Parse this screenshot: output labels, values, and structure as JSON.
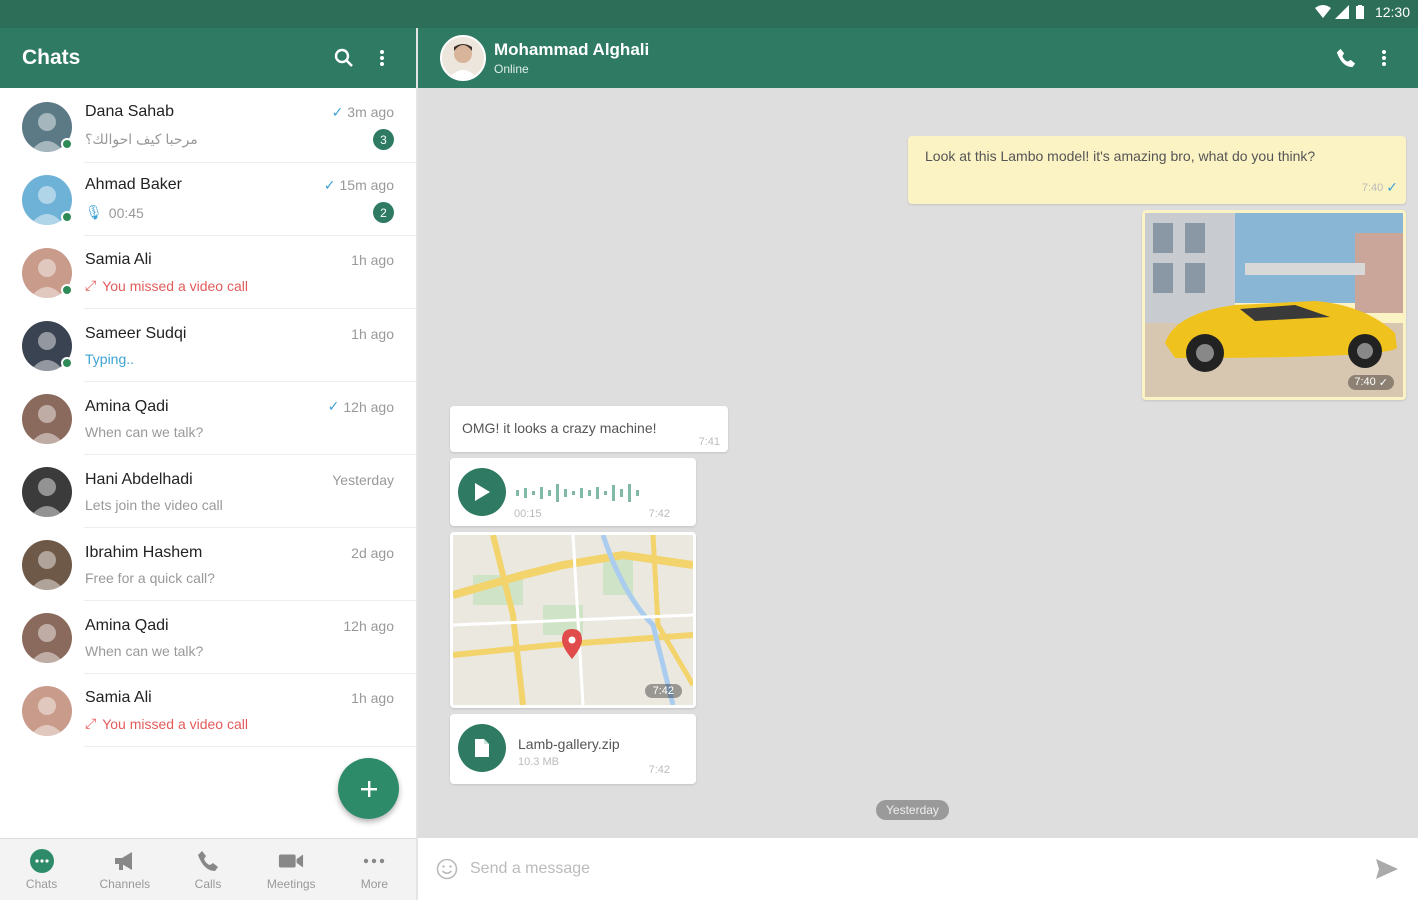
{
  "status": {
    "time": "12:30"
  },
  "sidebar": {
    "title": "Chats",
    "chats": [
      {
        "name": "Dana Sahab",
        "time": "3m ago",
        "message": "مرحبا كيف احوالك؟",
        "read": true,
        "badge": "3",
        "online": true,
        "avatar_color": "#5b7a86"
      },
      {
        "name": "Ahmad Baker",
        "time": "15m ago",
        "message": "00:45",
        "read": true,
        "badge": "2",
        "online": true,
        "voice": true,
        "avatar_color": "#6fb2d8"
      },
      {
        "name": "Samia Ali",
        "time": "1h ago",
        "message": "You missed a video call",
        "missed": true,
        "online": true,
        "avatar_color": "#c99b8a"
      },
      {
        "name": "Sameer Sudqi",
        "time": "1h ago",
        "message": "Typing..",
        "typing": true,
        "online": true,
        "avatar_color": "#3a4352"
      },
      {
        "name": "Amina Qadi",
        "time": "12h ago",
        "message": "When can we talk?",
        "read": true,
        "avatar_color": "#8a6a5c"
      },
      {
        "name": "Hani Abdelhadi",
        "time": "Yesterday",
        "message": "Lets join the video call",
        "avatar_color": "#3b3b3b"
      },
      {
        "name": "Ibrahim Hashem",
        "time": "2d ago",
        "message": "Free for a quick call?",
        "avatar_color": "#6e5848"
      },
      {
        "name": "Amina Qadi",
        "time": "12h ago",
        "message": "When can we talk?",
        "avatar_color": "#8a6a5c"
      },
      {
        "name": "Samia Ali",
        "time": "1h ago",
        "message": "You missed a video call",
        "missed": true,
        "avatar_color": "#c99b8a"
      }
    ]
  },
  "nav": [
    {
      "label": "Chats",
      "icon": "chat-bubble-icon"
    },
    {
      "label": "Channels",
      "icon": "megaphone-icon"
    },
    {
      "label": "Calls",
      "icon": "phone-icon"
    },
    {
      "label": "Meetings",
      "icon": "video-camera-icon"
    },
    {
      "label": "More",
      "icon": "more-dots-icon"
    }
  ],
  "conversation": {
    "contact_name": "Mohammad Alghali",
    "contact_status": "Online",
    "messages": {
      "out_text": "Look at this Lambo model! it's amazing bro, what do you think?",
      "out_text_time": "7:40",
      "out_image_time": "7:40",
      "in_text": "OMG! it looks a crazy machine!",
      "in_text_time": "7:41",
      "voice_duration": "00:15",
      "voice_time": "7:42",
      "map_time": "7:42",
      "file_name": "Lamb-gallery.zip",
      "file_size": "10.3 MB",
      "file_time": "7:42"
    },
    "day_separator": "Yesterday",
    "input_placeholder": "Send a message"
  },
  "colors": {
    "header": "#2e7a62",
    "accent": "#2e8b6a",
    "out_bubble": "#fbf3c4",
    "missed": "#e25b5b",
    "typing": "#3ea3d4"
  }
}
